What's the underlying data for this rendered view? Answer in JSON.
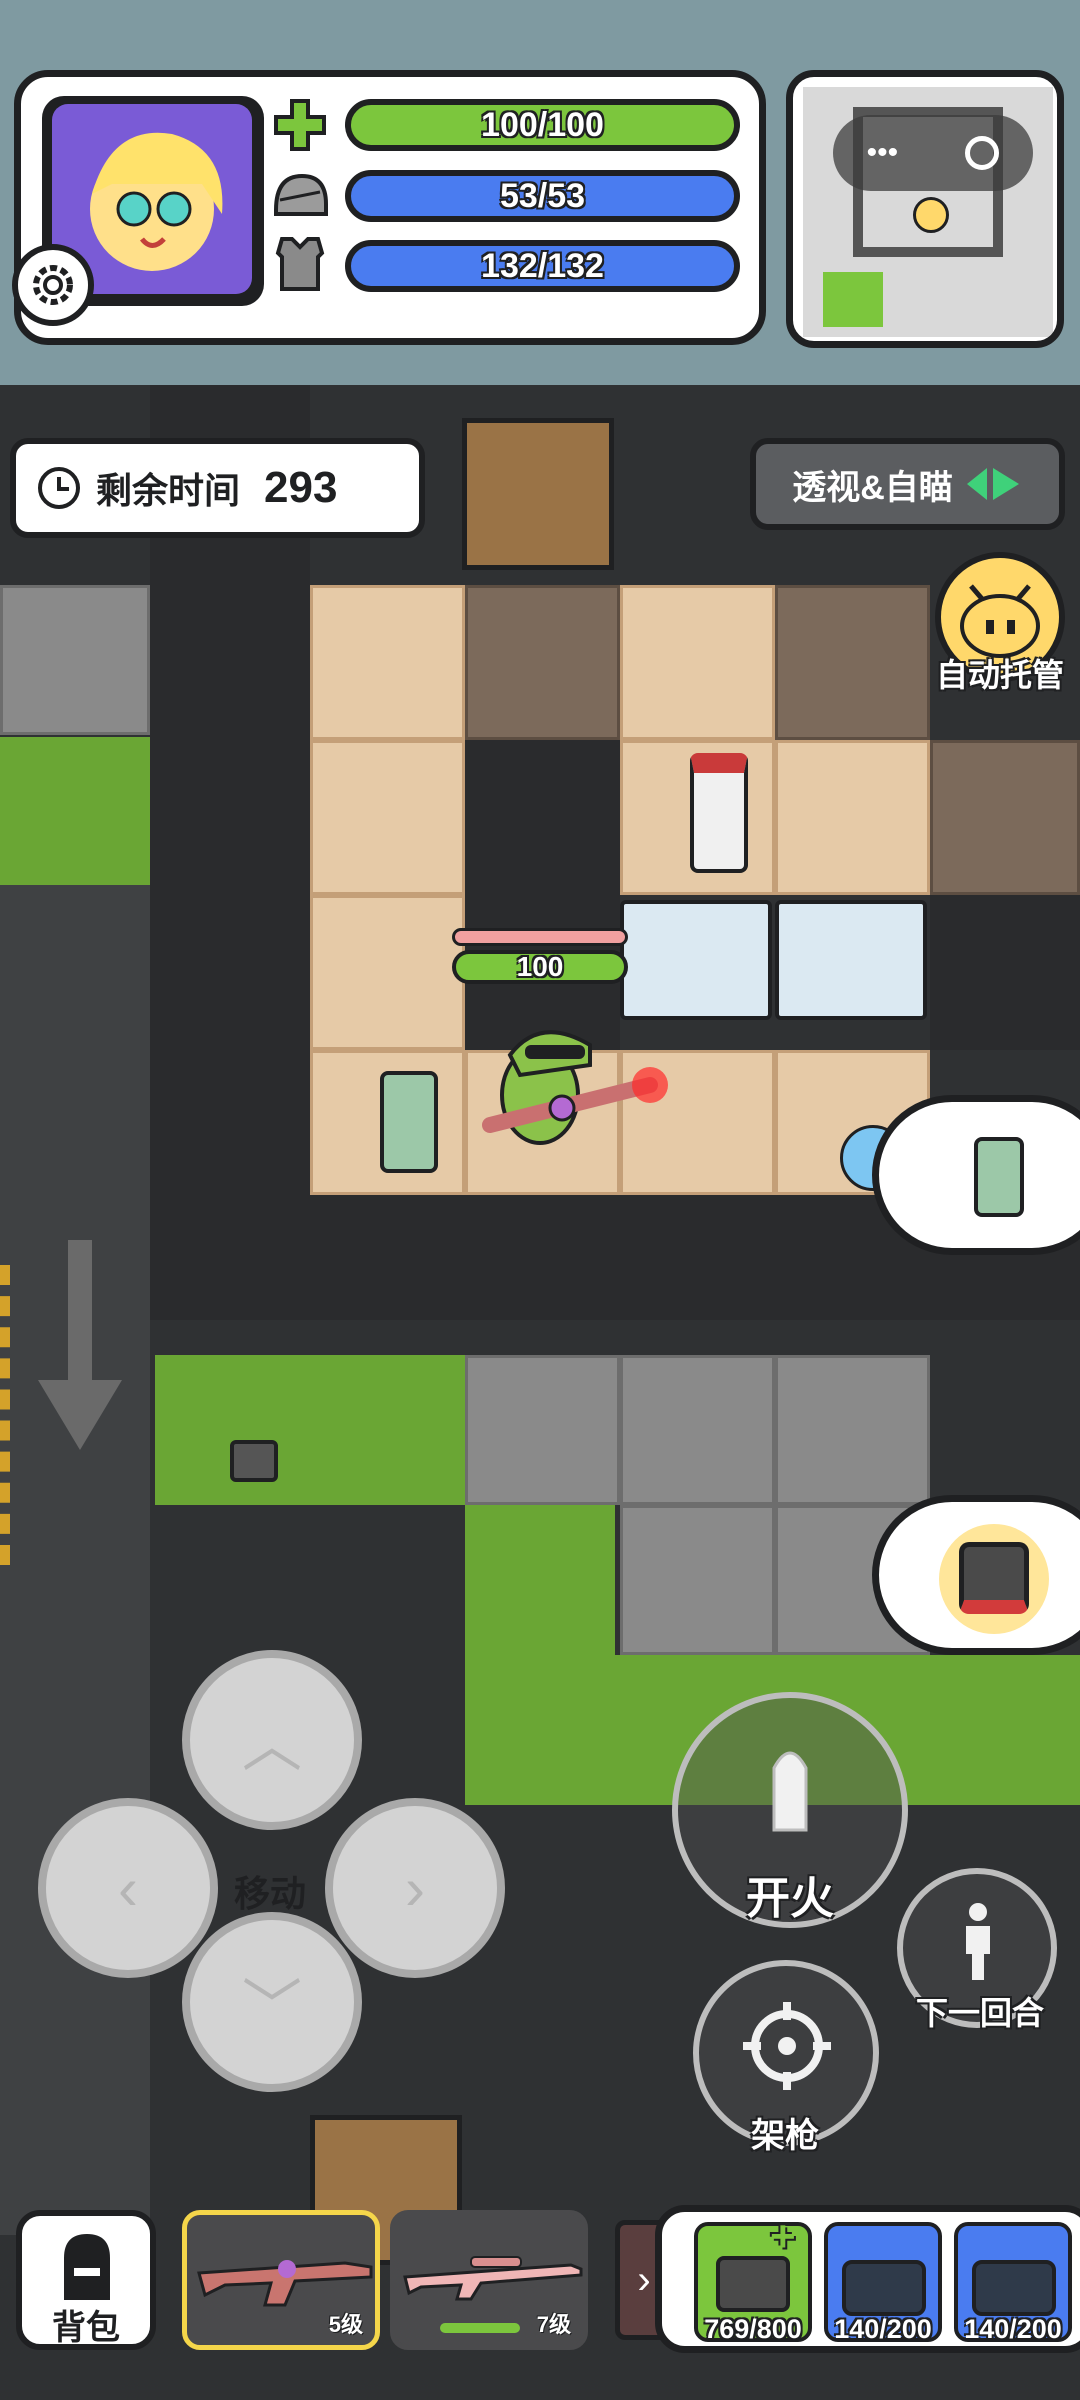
{
  "hud": {
    "health": "100/100",
    "helmet": "53/53",
    "armor": "132/132"
  },
  "timer": {
    "label": "剩余时间",
    "value": "293"
  },
  "xray_button": "透视&自瞄",
  "auto_button": "自动托管",
  "player": {
    "hp_label": "100"
  },
  "controls": {
    "move": "移动",
    "fire": "开火",
    "next_round": "下一回合",
    "aim": "架枪"
  },
  "bottom": {
    "bag": "背包",
    "weapon1_level": "5级",
    "weapon2_level": "7级",
    "medkit": "769/800",
    "helmet_bag": "140/200",
    "armor_bag": "140/200"
  },
  "colors": {
    "health_green": "#7cc63d",
    "shield_blue": "#4a7cf0",
    "selected_slot": "#f5d64a"
  }
}
